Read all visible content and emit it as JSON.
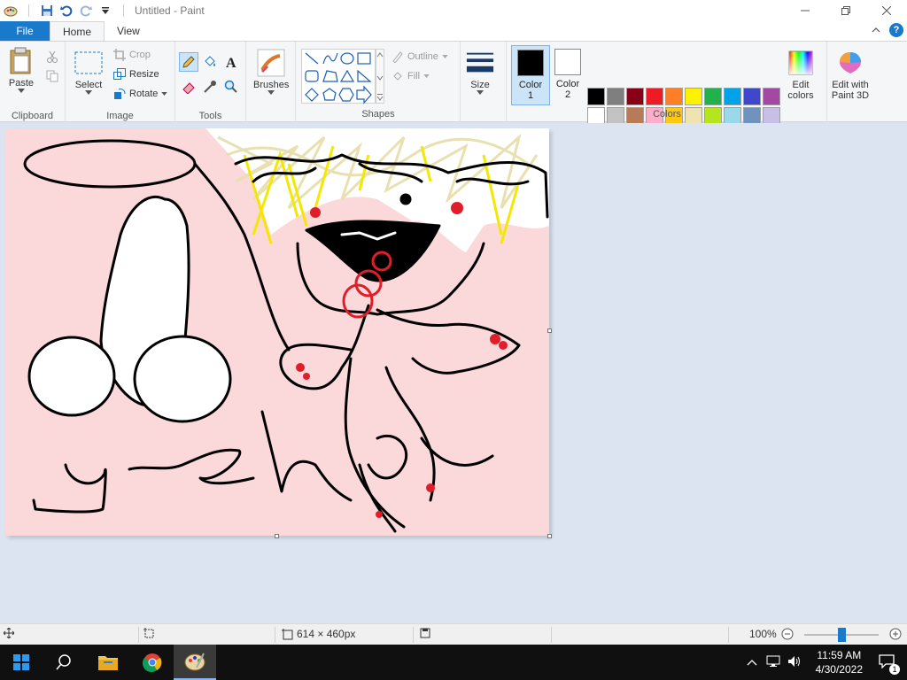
{
  "window": {
    "title": "Untitled - Paint"
  },
  "tabs": {
    "file": "File",
    "home": "Home",
    "view": "View"
  },
  "ribbon": {
    "clipboard": {
      "label": "Clipboard",
      "paste": "Paste"
    },
    "image": {
      "label": "Image",
      "select": "Select",
      "crop": "Crop",
      "resize": "Resize",
      "rotate": "Rotate"
    },
    "tools": {
      "label": "Tools"
    },
    "brushes": {
      "label": "Brushes"
    },
    "shapes": {
      "label": "Shapes",
      "outline": "Outline",
      "fill": "Fill"
    },
    "size": {
      "label": "Size"
    },
    "colors": {
      "label": "Colors",
      "color1": "Color",
      "color1_num": "1",
      "color2": "Color",
      "color2_num": "2",
      "edit_colors": "Edit",
      "edit_colors2": "colors",
      "paint3d": "Edit with",
      "paint3d2": "Paint 3D",
      "color1_value": "#000000",
      "color2_value": "#ffffff",
      "palette": [
        "#000000",
        "#7f7f7f",
        "#880015",
        "#ed1c24",
        "#ff7f27",
        "#fff200",
        "#22b14c",
        "#00a2e8",
        "#3f48cc",
        "#a349a4",
        "#ffffff",
        "#c3c3c3",
        "#b97a57",
        "#ffaec9",
        "#ffc90e",
        "#efe4b0",
        "#b5e61d",
        "#99d9ea",
        "#7092be",
        "#c8bfe7",
        "#e6ead0",
        "#f9d9dc",
        "#f3f3f3",
        "#f3f3f3",
        "#f3f3f3",
        "#f3f3f3",
        "#f3f3f3",
        "#f3f3f3",
        "#f3f3f3",
        "#f3f3f3"
      ]
    }
  },
  "canvas": {
    "background": "#fbd8da"
  },
  "status": {
    "dimensions": "614 × 460px",
    "zoom": "100%"
  },
  "taskbar": {
    "time": "11:59 AM",
    "date": "4/30/2022",
    "notifications": "1"
  }
}
